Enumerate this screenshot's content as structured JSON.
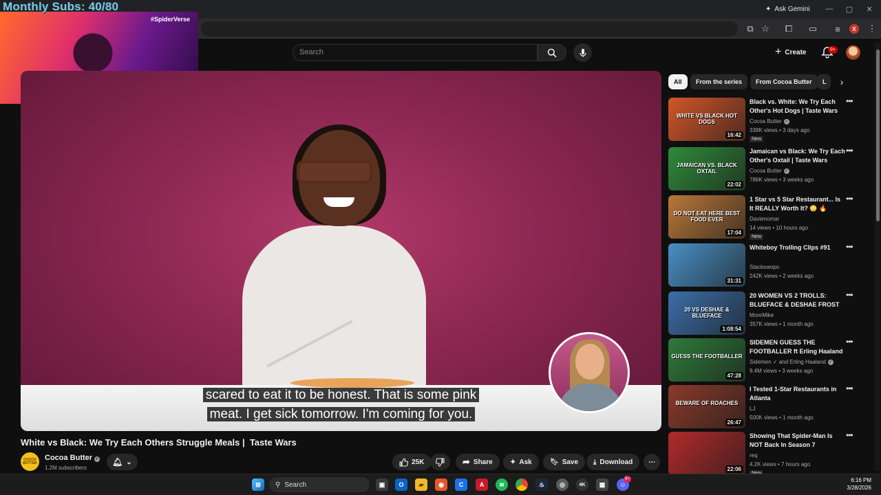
{
  "browser": {
    "gemini_label": "Ask Gemini",
    "profile_initial": "X"
  },
  "overlay": {
    "counter": "Monthly Subs: 40/80",
    "tag": "#SpiderVerse"
  },
  "header": {
    "search_placeholder": "Search",
    "create_label": "Create",
    "notification_badge": "9+"
  },
  "video": {
    "caption_line1": "scared to eat it to be honest. That is some pink",
    "caption_line2": "meat. I get sick tomorrow. I'm coming for you.",
    "title": "White vs Black: We Try Each Others Struggle Meals |  Taste Wars",
    "channel": "Cocoa Butter",
    "channel_logo_text": "COCOA BUTTER",
    "subscribers": "1.2M subscribers",
    "like_count": "25K",
    "actions": {
      "share": "Share",
      "ask": "Ask",
      "save": "Save",
      "download": "Download"
    }
  },
  "chips": [
    "All",
    "From the series",
    "From Cocoa Butter",
    "L"
  ],
  "recommendations": [
    {
      "title": "Black vs. White: We Try Each Other's Hot Dogs | Taste Wars",
      "channel": "Cocoa Butter",
      "verified": true,
      "meta": "338K views • 3 days ago",
      "badge": "New",
      "duration": "16:42",
      "thumb_text": "WHITE VS BLACK HOT DOGS",
      "thumb_color": "#d2562a"
    },
    {
      "title": "Jamaican vs Black: We Try Each Other's Oxtail |  Taste Wars",
      "channel": "Cocoa Butter",
      "verified": true,
      "meta": "786K views • 3 weeks ago",
      "badge": "",
      "duration": "22:02",
      "thumb_text": "JAMAICAN VS. BLACK OXTAIL",
      "thumb_color": "#2f8a3a"
    },
    {
      "title": "1 Star vs 5 Star Restaurant... Is It REALLY Worth It? 😳 🔥",
      "channel": "Davienomar",
      "verified": false,
      "meta": "14 views • 10 hours ago",
      "badge": "New",
      "duration": "17:04",
      "thumb_text": "DO NOT EAT HERE  BEST FOOD EVER",
      "thumb_color": "#b9773a"
    },
    {
      "title": "Whiteboy Trolling Clips #91",
      "channel": "Stackswopo",
      "verified": false,
      "meta": "242K views • 2 weeks ago",
      "badge": "",
      "duration": "31:31",
      "thumb_text": "",
      "thumb_color": "#4a8fc4"
    },
    {
      "title": "20 WOMEN VS 2 TROLLS: BLUEFACE & DESHAE FROST",
      "channel": "MoreMike",
      "verified": false,
      "meta": "357K views • 1 month ago",
      "badge": "",
      "duration": "1:08:54",
      "thumb_text": "20 VS DESHAE & BLUEFACE",
      "thumb_color": "#3b6ea8"
    },
    {
      "title": "SIDEMEN GUESS THE FOOTBALLER ft Erling Haaland",
      "channel": "Sidemen ✓ and Erling Haaland",
      "verified": true,
      "meta": "9.4M views • 3 weeks ago",
      "badge": "",
      "duration": "47:28",
      "thumb_text": "GUESS THE FOOTBALLER",
      "thumb_color": "#2e7a3a"
    },
    {
      "title": "I Tested 1-Star Restaurants in Atlanta",
      "channel": "LJ",
      "verified": false,
      "meta": "500K views • 1 month ago",
      "badge": "",
      "duration": "26:47",
      "thumb_text": "BEWARE OF ROACHES",
      "thumb_color": "#8a3a2a"
    },
    {
      "title": "Showing That Spider-Man Is NOT Back In Season 7",
      "channel": "req",
      "verified": false,
      "meta": "4.2K views • 7 hours ago",
      "badge": "New",
      "duration": "22:06",
      "thumb_text": "",
      "thumb_color": "#b22a2a"
    }
  ],
  "taskbar": {
    "search_label": "Search",
    "time": "6:16 PM",
    "date": "3/28/2026",
    "discord_badge": "9+"
  }
}
